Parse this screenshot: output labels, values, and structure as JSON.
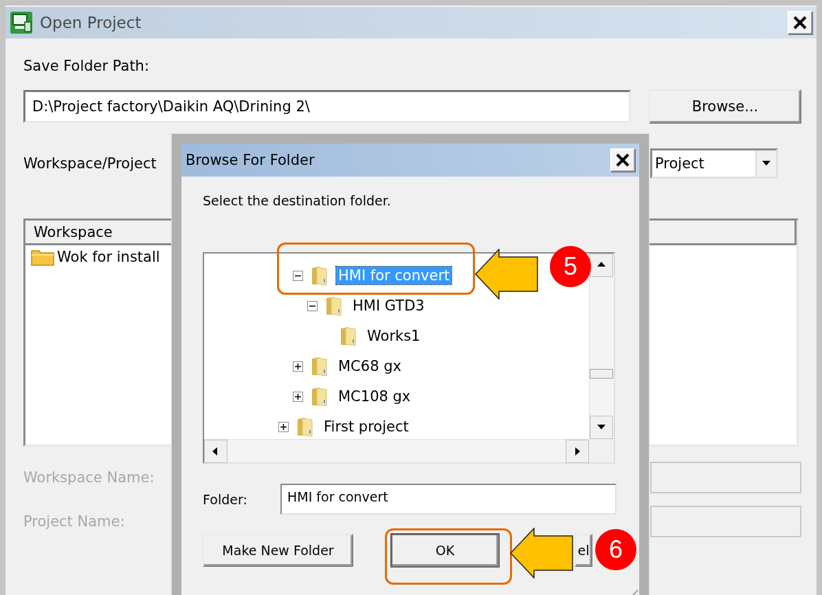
{
  "window": {
    "title": "Open Project"
  },
  "save_folder_path": {
    "label": "Save Folder Path:",
    "value": "D:\\Project factory\\Daikin AQ\\Drining 2\\",
    "browse_button": "Browse..."
  },
  "workspace_project": {
    "label": "Workspace/Project",
    "dropdown_value": "Project"
  },
  "workspace_list": {
    "column": "Workspace",
    "items": [
      {
        "label": "Wok for install"
      }
    ]
  },
  "workspace_name": {
    "label": "Workspace Name:",
    "disabled": true
  },
  "project_name": {
    "label": "Project Name:",
    "disabled": true
  },
  "browse_dialog": {
    "title": "Browse For Folder",
    "instruction": "Select the destination folder.",
    "tree": {
      "items": [
        {
          "label": "HMI for convert",
          "expanded": true,
          "selected": true,
          "children": [
            {
              "label": "HMI GTD3",
              "expanded": true,
              "selected": false,
              "children": [
                {
                  "label": "Works1",
                  "selected": false
                }
              ]
            }
          ]
        },
        {
          "label": "MC68 gx",
          "expanded": false,
          "selected": false
        },
        {
          "label": "MC108 gx",
          "expanded": false,
          "selected": false
        }
      ],
      "outer_items": [
        {
          "label": "First project",
          "expanded": false,
          "selected": false
        }
      ]
    },
    "folder": {
      "label": "Folder:",
      "value": "HMI for convert"
    },
    "buttons": [
      {
        "label": "Make New Folder",
        "default": false
      },
      {
        "label": "OK",
        "default": true
      },
      {
        "label": "el",
        "default": false
      }
    ]
  },
  "callouts": [
    {
      "number": "5"
    },
    {
      "number": "6"
    }
  ]
}
